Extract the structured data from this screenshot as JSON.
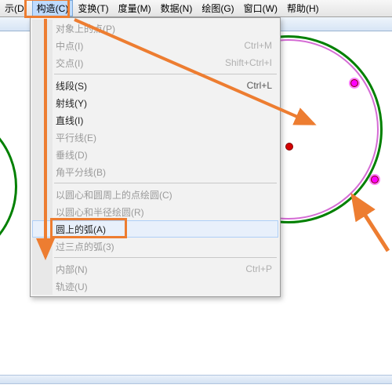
{
  "menubar": {
    "items": [
      {
        "label": "示(D)"
      },
      {
        "label": "构造(C)",
        "active": true
      },
      {
        "label": "变换(T)"
      },
      {
        "label": "度量(M)"
      },
      {
        "label": "数据(N)"
      },
      {
        "label": "绘图(G)"
      },
      {
        "label": "窗口(W)"
      },
      {
        "label": "帮助(H)"
      }
    ]
  },
  "menu": {
    "groups": [
      [
        {
          "label": "对象上的点(P)",
          "disabled": true
        },
        {
          "label": "中点(I)",
          "disabled": true,
          "shortcut": "Ctrl+M"
        },
        {
          "label": "交点(I)",
          "disabled": true,
          "shortcut": "Shift+Ctrl+I"
        }
      ],
      [
        {
          "label": "线段(S)",
          "disabled": false,
          "shortcut": "Ctrl+L"
        },
        {
          "label": "射线(Y)",
          "disabled": false
        },
        {
          "label": "直线(I)",
          "disabled": false
        },
        {
          "label": "平行线(E)",
          "disabled": true
        },
        {
          "label": "垂线(D)",
          "disabled": true
        },
        {
          "label": "角平分线(B)",
          "disabled": true
        }
      ],
      [
        {
          "label": "以圆心和圆周上的点绘圆(C)",
          "disabled": true
        },
        {
          "label": "以圆心和半径绘圆(R)",
          "disabled": true
        },
        {
          "label": "圆上的弧(A)",
          "disabled": false,
          "hover": true,
          "highlight": true
        },
        {
          "label": "过三点的弧(3)",
          "disabled": true
        }
      ],
      [
        {
          "label": "内部(N)",
          "disabled": true,
          "shortcut": "Ctrl+P"
        },
        {
          "label": "轨迹(U)",
          "disabled": true
        }
      ]
    ]
  },
  "colors": {
    "highlight": "#ed7d31"
  }
}
